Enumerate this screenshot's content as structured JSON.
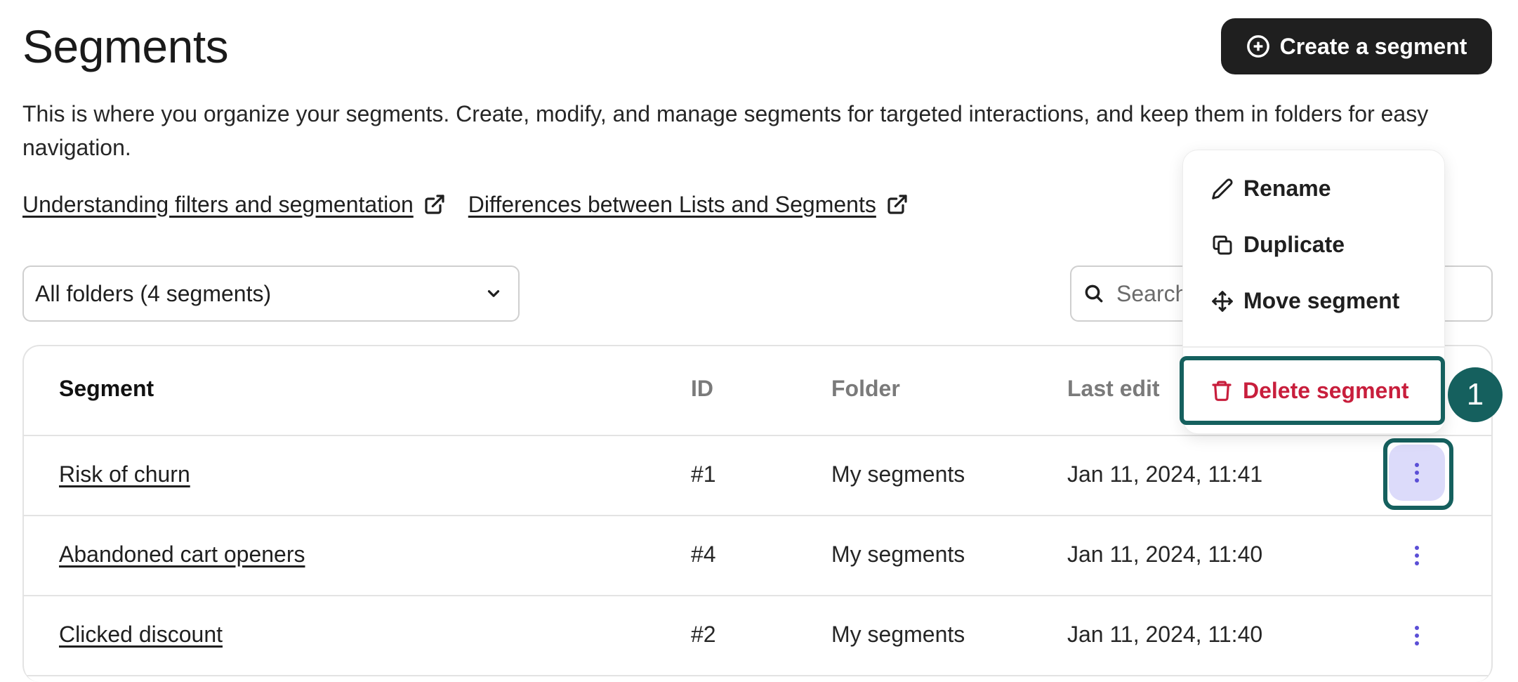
{
  "header": {
    "title": "Segments",
    "create_button_label": "Create a segment"
  },
  "description": "This is where you organize your segments. Create, modify, and manage segments for targeted interactions, and keep them in folders for easy navigation.",
  "help_links": [
    {
      "label": "Understanding filters and segmentation",
      "icon": "external-link-icon"
    },
    {
      "label": "Differences between Lists and Segments",
      "icon": "external-link-icon"
    }
  ],
  "toolbar": {
    "folder_filter_value": "All folders (4 segments)",
    "search_placeholder": "Search"
  },
  "table": {
    "columns": [
      "Segment",
      "ID",
      "Folder",
      "Last edit"
    ],
    "rows": [
      {
        "name": "Risk of churn",
        "id": "#1",
        "folder": "My segments",
        "last_edit": "Jan 11, 2024, 11:41"
      },
      {
        "name": "Abandoned cart openers",
        "id": "#4",
        "folder": "My segments",
        "last_edit": "Jan 11, 2024, 11:40"
      },
      {
        "name": "Clicked discount",
        "id": "#2",
        "folder": "My segments",
        "last_edit": "Jan 11, 2024, 11:40"
      }
    ]
  },
  "context_menu": {
    "items": [
      {
        "label": "Rename",
        "icon": "pencil-icon"
      },
      {
        "label": "Duplicate",
        "icon": "copy-icon"
      },
      {
        "label": "Move segment",
        "icon": "move-icon"
      }
    ],
    "danger_item": {
      "label": "Delete segment",
      "icon": "trash-icon"
    }
  },
  "annotation": {
    "step_number": "1"
  },
  "colors": {
    "primary_button": "#1f1f1f",
    "highlight_ring": "#15605e",
    "danger": "#c81e3c",
    "kebab_active_bg": "#dcdbfa",
    "kebab_dots": "#5b4fd6"
  }
}
